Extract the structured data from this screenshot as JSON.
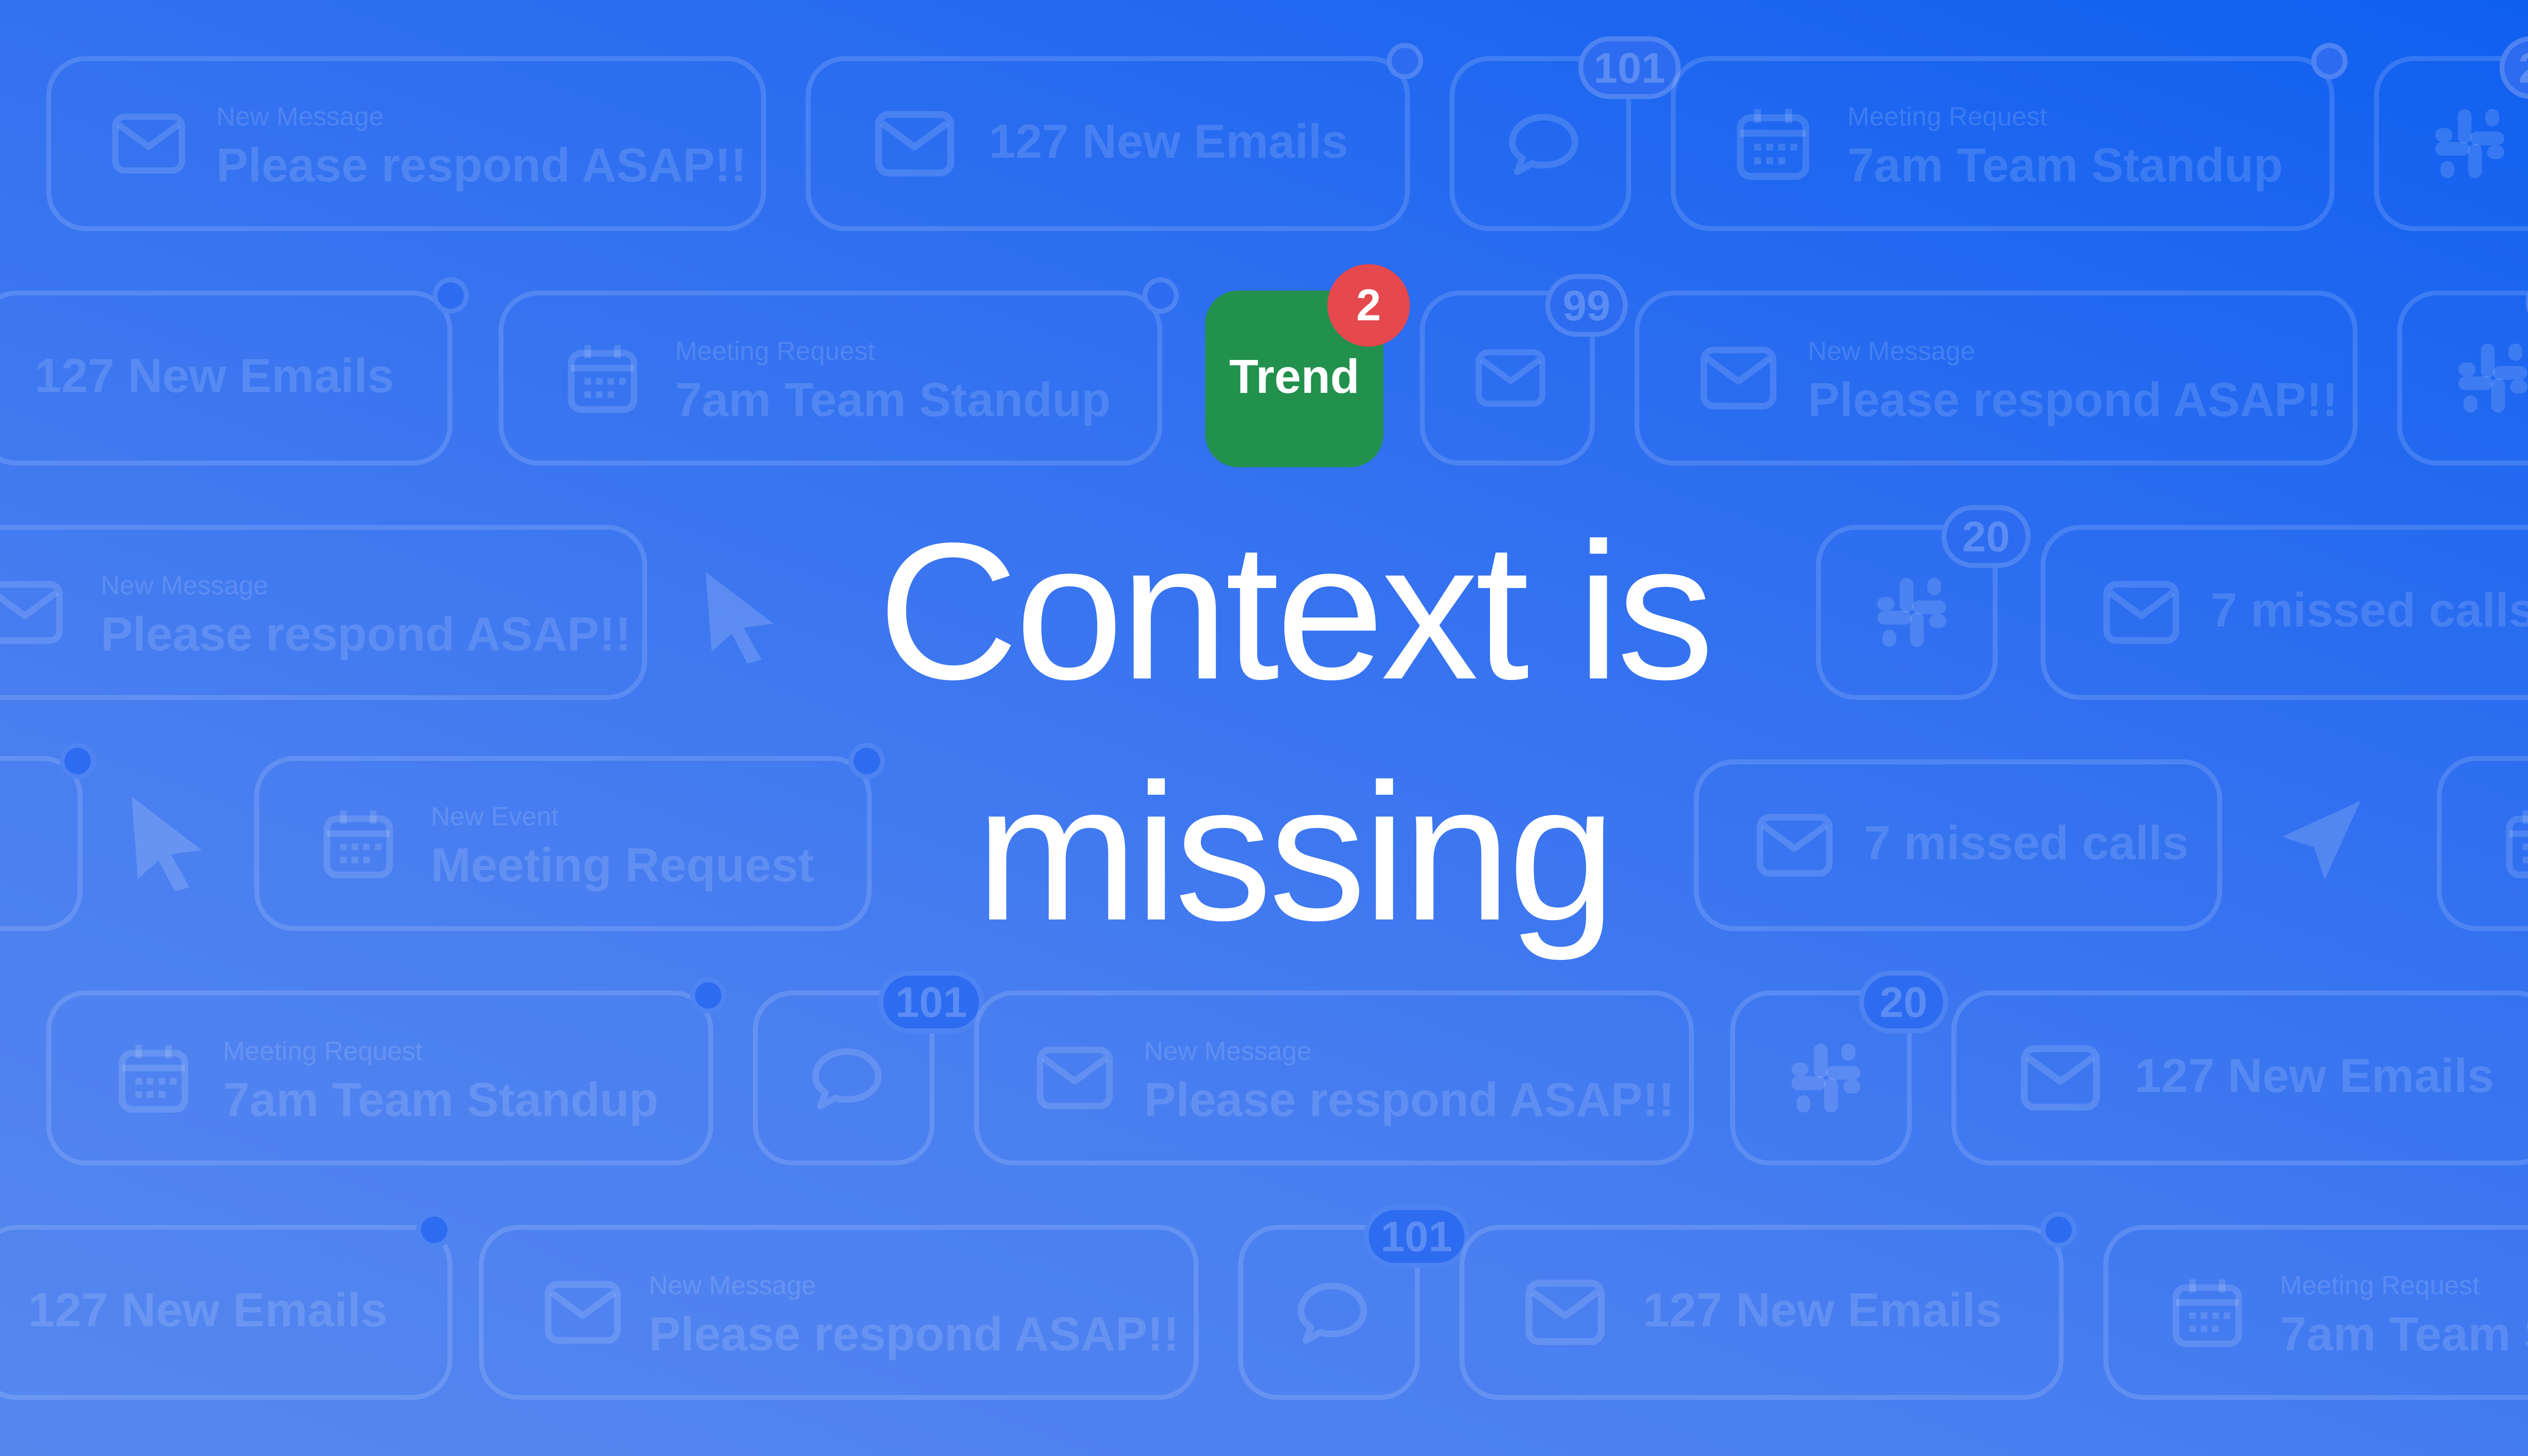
{
  "logo": {
    "name": "Trend",
    "badge_count": "2"
  },
  "headline": {
    "line1": "Context is",
    "line2": "missing"
  },
  "tiles": {
    "new_message": "New Message",
    "please_respond": "Please respond ASAP!!",
    "new_emails": "127 New Emails",
    "meeting_request": "Meeting Request",
    "team_standup": "7am Team Standup",
    "team_standup_cut": "7am Team Sta",
    "missed_calls": "7 missed calls",
    "new_event": "New Event",
    "count_101": "101",
    "count_99": "99",
    "count_20": "20",
    "emails_cut": "127 New Emails"
  },
  "icons": [
    "mail-icon",
    "chat-bubble-icon",
    "calendar-icon",
    "slack-icon",
    "cursor-arrow-icon",
    "send-plane-icon"
  ],
  "colors": {
    "background_top": "#0f5ff0",
    "background_bottom": "#5587ef",
    "logo_green": "#23914e",
    "badge_red": "#e5484d",
    "text": "#ffffff"
  }
}
